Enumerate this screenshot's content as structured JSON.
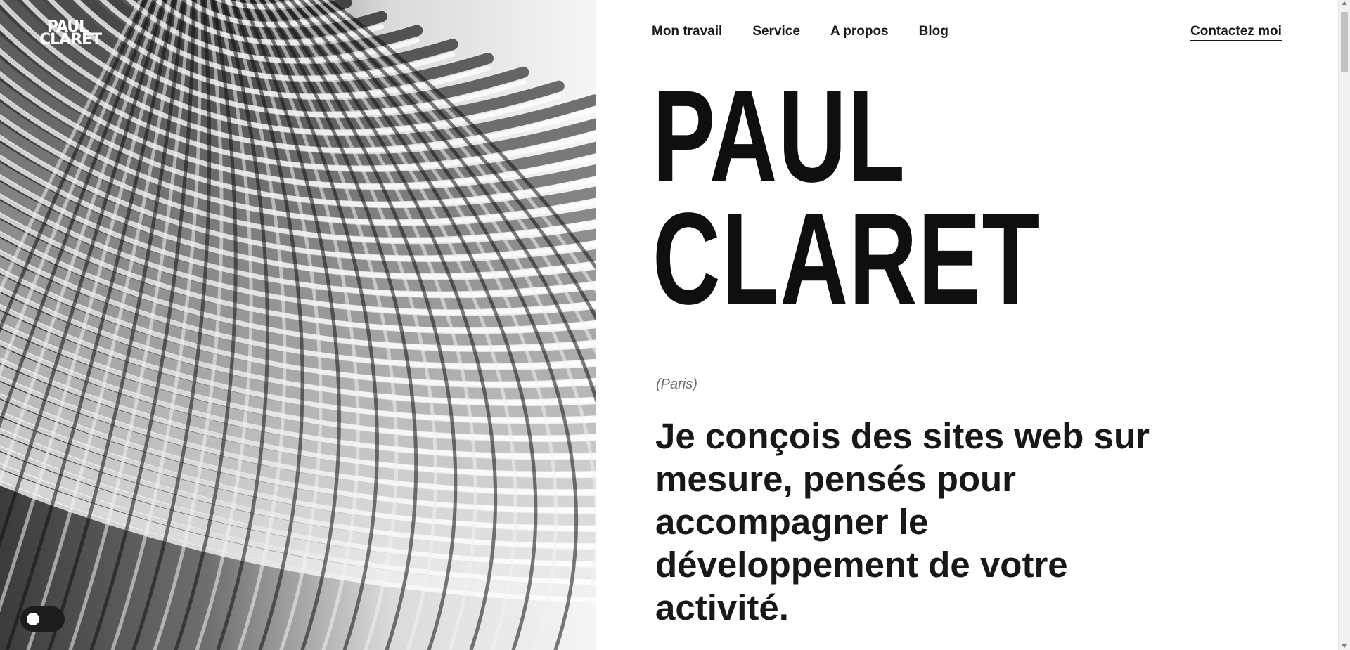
{
  "logo": {
    "line1": "PAUL",
    "line2": "CLARET"
  },
  "nav": {
    "items": [
      {
        "label": "Mon travail"
      },
      {
        "label": "Service"
      },
      {
        "label": "A propos"
      },
      {
        "label": "Blog"
      }
    ],
    "contact_label": "Contactez moi"
  },
  "hero": {
    "name_line1": "PAUL",
    "name_line2": "CLARET",
    "location": "(Paris)",
    "tagline": "Je conçois des sites web sur mesure, pensés pour accompagner le développement de votre activité."
  },
  "colors": {
    "text": "#111214",
    "background": "#ffffff",
    "muted": "#6a6b6d",
    "toggle": "#1b1c1e"
  }
}
